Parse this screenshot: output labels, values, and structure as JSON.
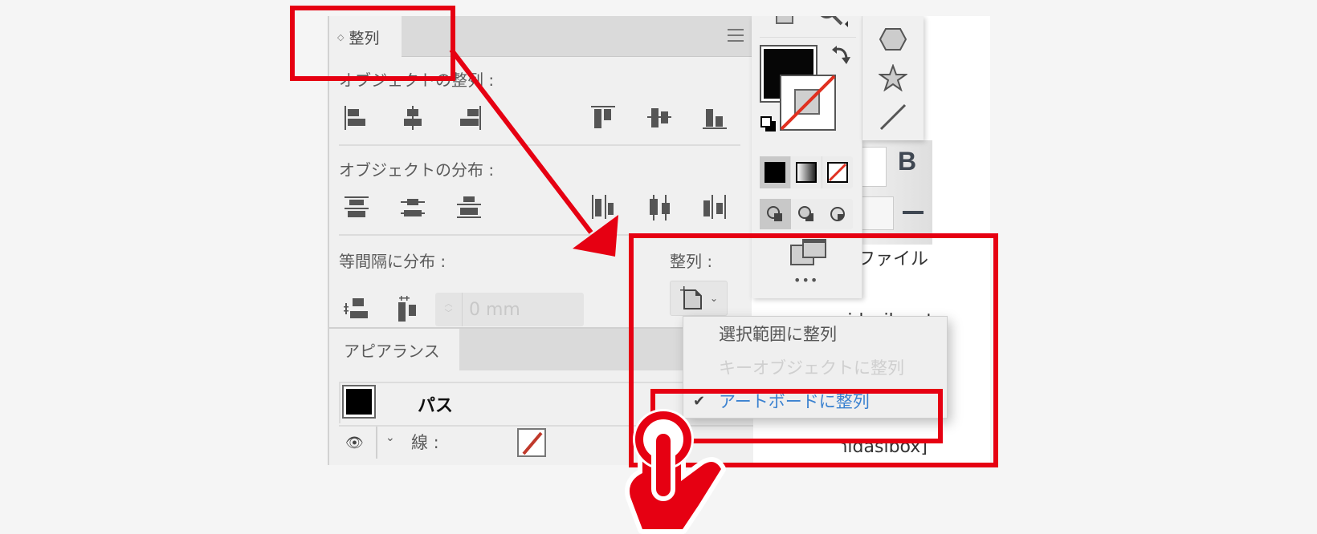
{
  "align_panel": {
    "tab_label": "整列",
    "sections": {
      "align_objects": "オブジェクトの整列 :",
      "distribute_objects": "オブジェクトの分布 :",
      "distribute_spacing": "等間隔に分布 :",
      "align_to": "整列 :"
    },
    "spacing_value": "0 mm",
    "align_buttons": [
      "horizontal-align-left",
      "horizontal-align-center",
      "horizontal-align-right",
      "vertical-align-top",
      "vertical-align-center",
      "vertical-align-bottom"
    ],
    "distribute_buttons": [
      "vertical-distribute-top",
      "vertical-distribute-center",
      "vertical-distribute-bottom",
      "horizontal-distribute-left",
      "horizontal-distribute-center",
      "horizontal-distribute-right"
    ]
  },
  "align_to_menu": {
    "items": [
      {
        "label": "選択範囲に整列",
        "checked": false,
        "disabled": false
      },
      {
        "label": "キーオブジェクトに整列",
        "checked": false,
        "disabled": true
      },
      {
        "label": "アートボードに整列",
        "checked": true,
        "disabled": false
      }
    ],
    "check_glyph": "✔"
  },
  "appearance_panel": {
    "tab_label": "アピアランス",
    "object_label": "パス",
    "stroke_label": "線 :"
  },
  "tools_panel": {
    "more_label": "•••",
    "shapes": [
      "hexagon-tool",
      "star-tool",
      "line-tool"
    ]
  },
  "background_text": {
    "line1": "ファイル",
    "line2": "midasibox title=\"対",
    "line3": "midasibox]",
    "bold_button": "B"
  },
  "colors": {
    "annotation_red": "#e60012",
    "link_blue": "#3b82d0",
    "disabled_text": "#c8c8c8"
  }
}
